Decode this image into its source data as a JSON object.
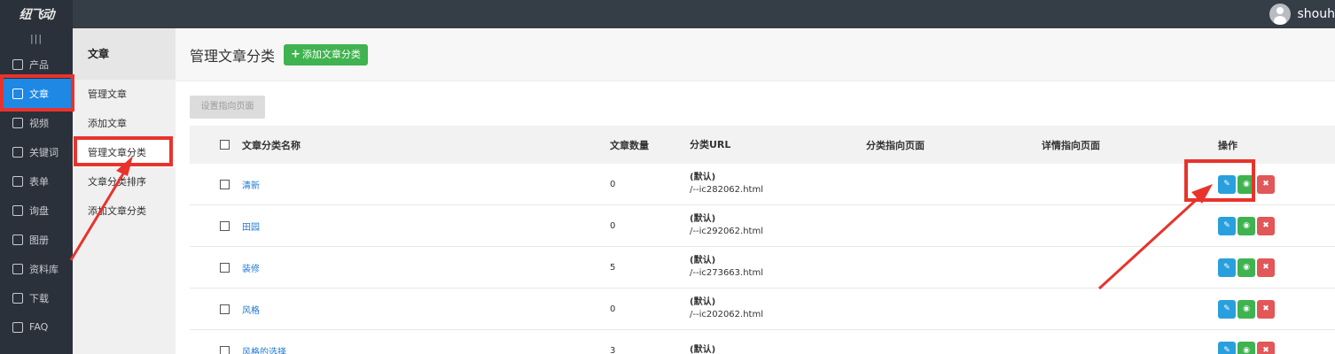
{
  "app": {
    "logo": "纽飞动",
    "username": "shouh"
  },
  "sidebar": {
    "collapse": "|||",
    "items": [
      {
        "label": "产品",
        "icon": "grid-icon"
      },
      {
        "label": "文章",
        "icon": "document-icon"
      },
      {
        "label": "视频",
        "icon": "play-icon"
      },
      {
        "label": "关键词",
        "icon": "keyword-icon"
      },
      {
        "label": "表单",
        "icon": "clipboard-icon"
      },
      {
        "label": "询盘",
        "icon": "inquiry-icon"
      },
      {
        "label": "图册",
        "icon": "gallery-icon"
      },
      {
        "label": "资料库",
        "icon": "database-icon"
      },
      {
        "label": "下载",
        "icon": "download-icon"
      },
      {
        "label": "FAQ",
        "icon": "question-icon"
      }
    ]
  },
  "submenu": {
    "title": "文章",
    "items": [
      "管理文章",
      "添加文章",
      "管理文章分类",
      "文章分类排序",
      "添加文章分类"
    ]
  },
  "page": {
    "title": "管理文章分类",
    "add_button": "添加文章分类",
    "set_button": "设置指向页面"
  },
  "table": {
    "headers": {
      "name": "文章分类名称",
      "count": "文章数量",
      "url": "分类URL",
      "category_page": "分类指向页面",
      "detail_page": "详情指向页面",
      "ops": "操作"
    },
    "rows": [
      {
        "name": "清新",
        "count": "0",
        "url_default": "(默认)",
        "url": "/--ic282062.html"
      },
      {
        "name": "田园",
        "count": "0",
        "url_default": "(默认)",
        "url": "/--ic292062.html"
      },
      {
        "name": "装修",
        "count": "5",
        "url_default": "(默认)",
        "url": "/--ic273663.html"
      },
      {
        "name": "风格",
        "count": "0",
        "url_default": "(默认)",
        "url": "/--ic202062.html"
      },
      {
        "name": "风格的选择",
        "count": "3",
        "url_default": "(默认)",
        "url": ""
      }
    ]
  },
  "colors": {
    "topbar": "#353d47",
    "sidebar": "#2b313a",
    "active": "#1e88e5",
    "add_green": "#3fb34f",
    "edit_blue": "#2a9fde",
    "delete_red": "#e25757",
    "annotation_red": "#e8332d"
  }
}
